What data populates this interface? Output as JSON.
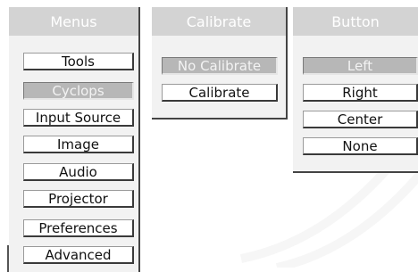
{
  "menus_panel": {
    "title": "Menus",
    "items": [
      {
        "label": "Tools",
        "selected": false
      },
      {
        "label": "Cyclops",
        "selected": true
      },
      {
        "label": "Input Source",
        "selected": false
      },
      {
        "label": "Image",
        "selected": false
      },
      {
        "label": "Audio",
        "selected": false
      },
      {
        "label": "Projector",
        "selected": false
      },
      {
        "label": "Preferences",
        "selected": false
      },
      {
        "label": "Advanced",
        "selected": false
      }
    ]
  },
  "calibrate_panel": {
    "title": "Calibrate",
    "items": [
      {
        "label": "No Calibrate",
        "selected": true
      },
      {
        "label": "Calibrate",
        "selected": false
      }
    ]
  },
  "button_panel": {
    "title": "Button",
    "items": [
      {
        "label": "Left",
        "selected": true
      },
      {
        "label": "Right",
        "selected": false
      },
      {
        "label": "Center",
        "selected": false
      },
      {
        "label": "None",
        "selected": false
      }
    ]
  },
  "colors": {
    "header_bg": "#d3d3d3",
    "panel_bg": "#f2f2f2",
    "selected_bg": "#b7b7b7",
    "button_bg": "#ffffff"
  }
}
